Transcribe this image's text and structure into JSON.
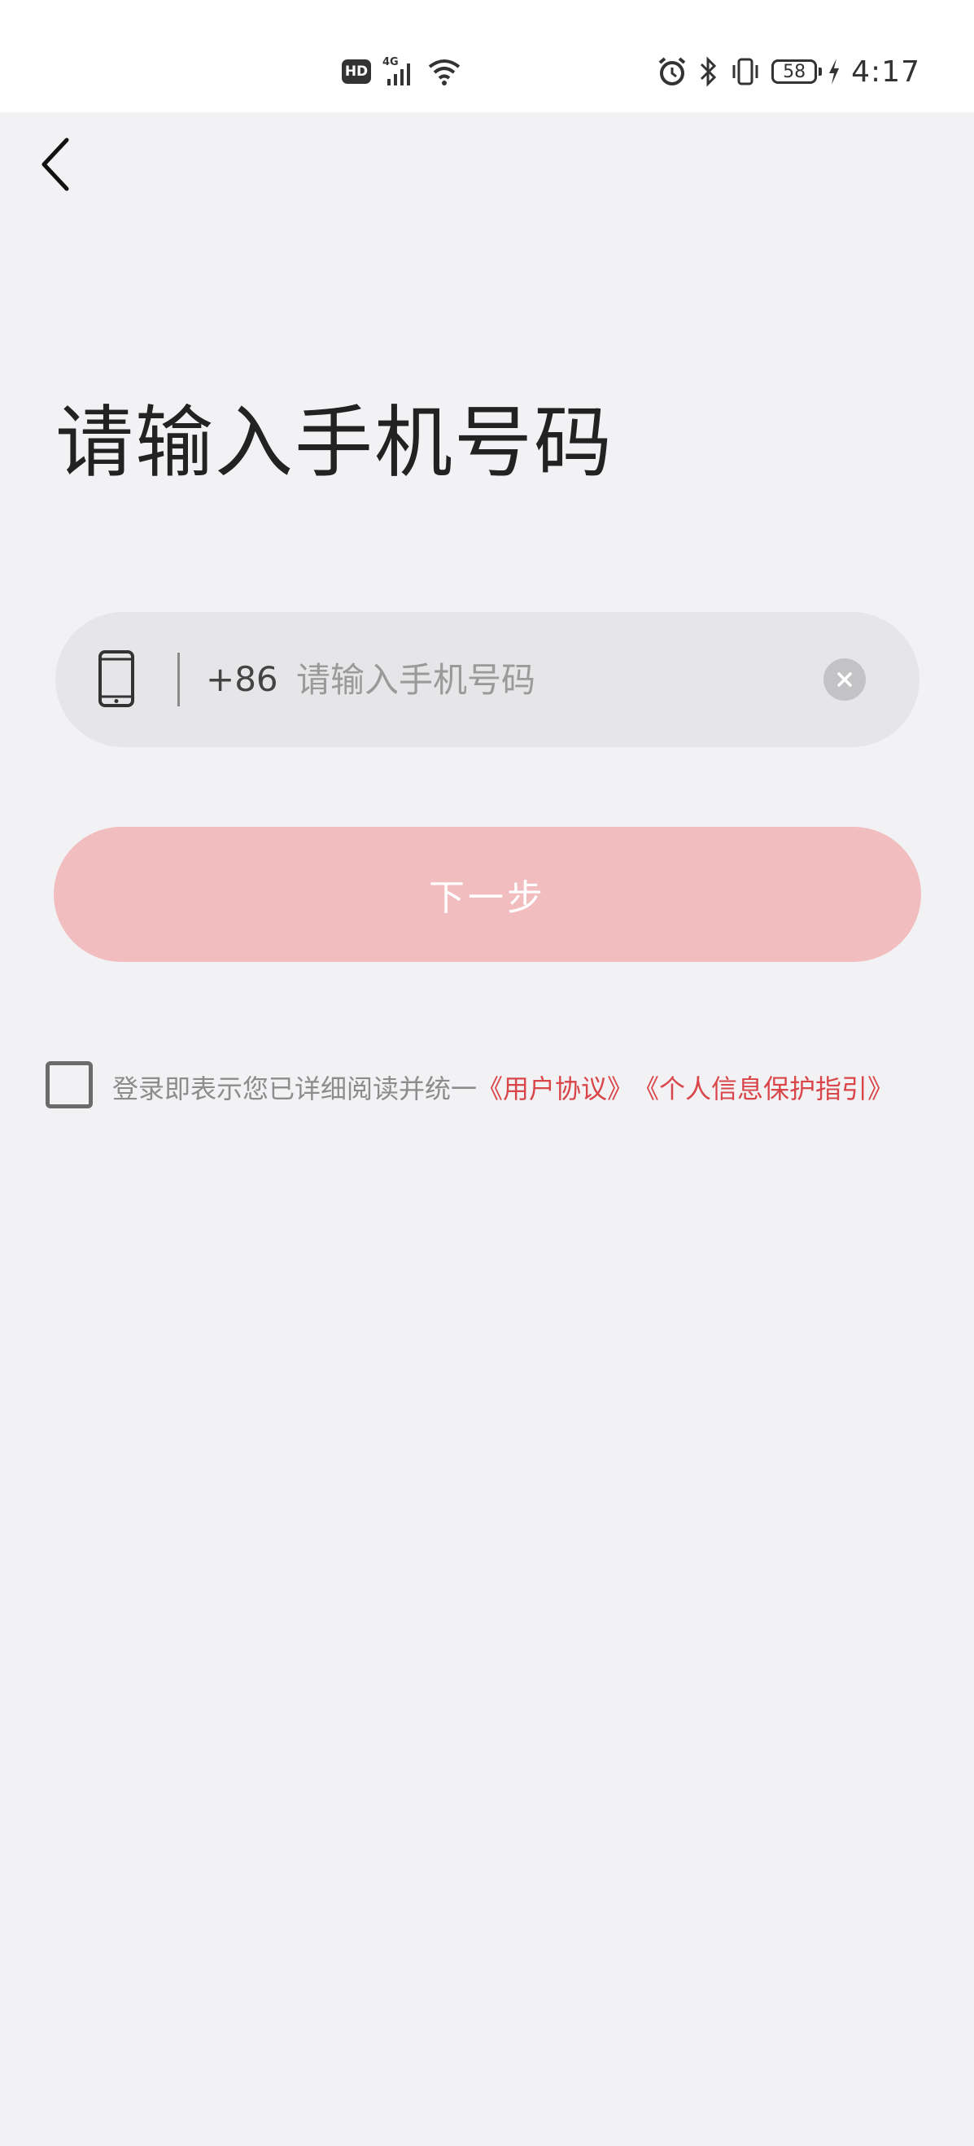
{
  "status_bar": {
    "network_badge": "HD",
    "network_type": "4G",
    "battery_level": "58",
    "time": "4:17",
    "icons": [
      "signal-icon",
      "wifi-icon",
      "alarm-icon",
      "bluetooth-icon",
      "vibrate-icon",
      "battery-icon",
      "charging-icon"
    ]
  },
  "header": {
    "back_icon": "chevron-left-icon"
  },
  "main": {
    "title": "请输入手机号码",
    "phone_field": {
      "country_code": "+86",
      "value": "",
      "placeholder": "请输入手机号码",
      "icon": "smartphone-icon",
      "clear_icon": "clear-icon"
    },
    "next_button_label": "下一步",
    "agreement": {
      "checked": false,
      "text": "登录即表示您已详细阅读并统一",
      "user_agreement_link": "《用户协议》",
      "privacy_link": "《个人信息保护指引》"
    }
  },
  "colors": {
    "background": "#f2f2f4",
    "accent": "#d9464a",
    "button_disabled": "#f1bdbe",
    "input_background": "#e6e6e8"
  }
}
